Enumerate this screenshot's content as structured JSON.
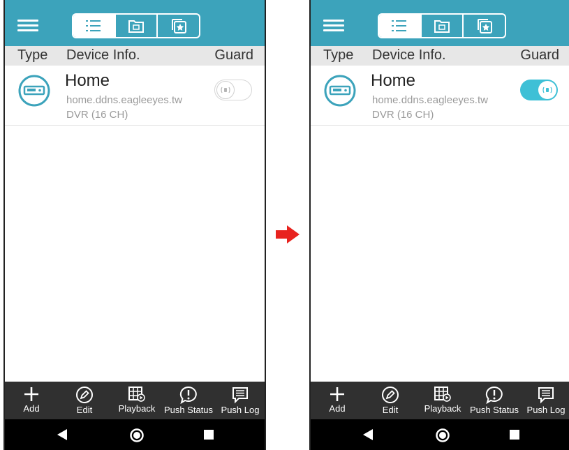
{
  "screens": [
    {
      "header": {
        "type": "Type",
        "device_info": "Device Info.",
        "guard": "Guard"
      },
      "device": {
        "name": "Home",
        "host": "home.ddns.eagleeyes.tw",
        "type": "DVR (16 CH)",
        "guard_on": false
      },
      "bottom_bar": {
        "add": "Add",
        "edit": "Edit",
        "playback": "Playback",
        "push_status": "Push Status",
        "push_log": "Push Log"
      }
    },
    {
      "header": {
        "type": "Type",
        "device_info": "Device Info.",
        "guard": "Guard"
      },
      "device": {
        "name": "Home",
        "host": "home.ddns.eagleeyes.tw",
        "type": "DVR (16 CH)",
        "guard_on": true
      },
      "bottom_bar": {
        "add": "Add",
        "edit": "Edit",
        "playback": "Playback",
        "push_status": "Push Status",
        "push_log": "Push Log"
      }
    }
  ],
  "colors": {
    "topbar": "#3ca3bb",
    "toggle_on": "#3ec0d6",
    "arrow": "#e8231f",
    "bottom_bar": "#303030"
  },
  "icons": {
    "top_tabs": [
      "list-icon",
      "folder-icon",
      "favorites-icon"
    ],
    "bottom": [
      "plus-icon",
      "pencil-icon",
      "playback-icon",
      "push-status-icon",
      "push-log-icon"
    ],
    "nav": [
      "back-icon",
      "home-icon",
      "recent-apps-icon"
    ]
  }
}
